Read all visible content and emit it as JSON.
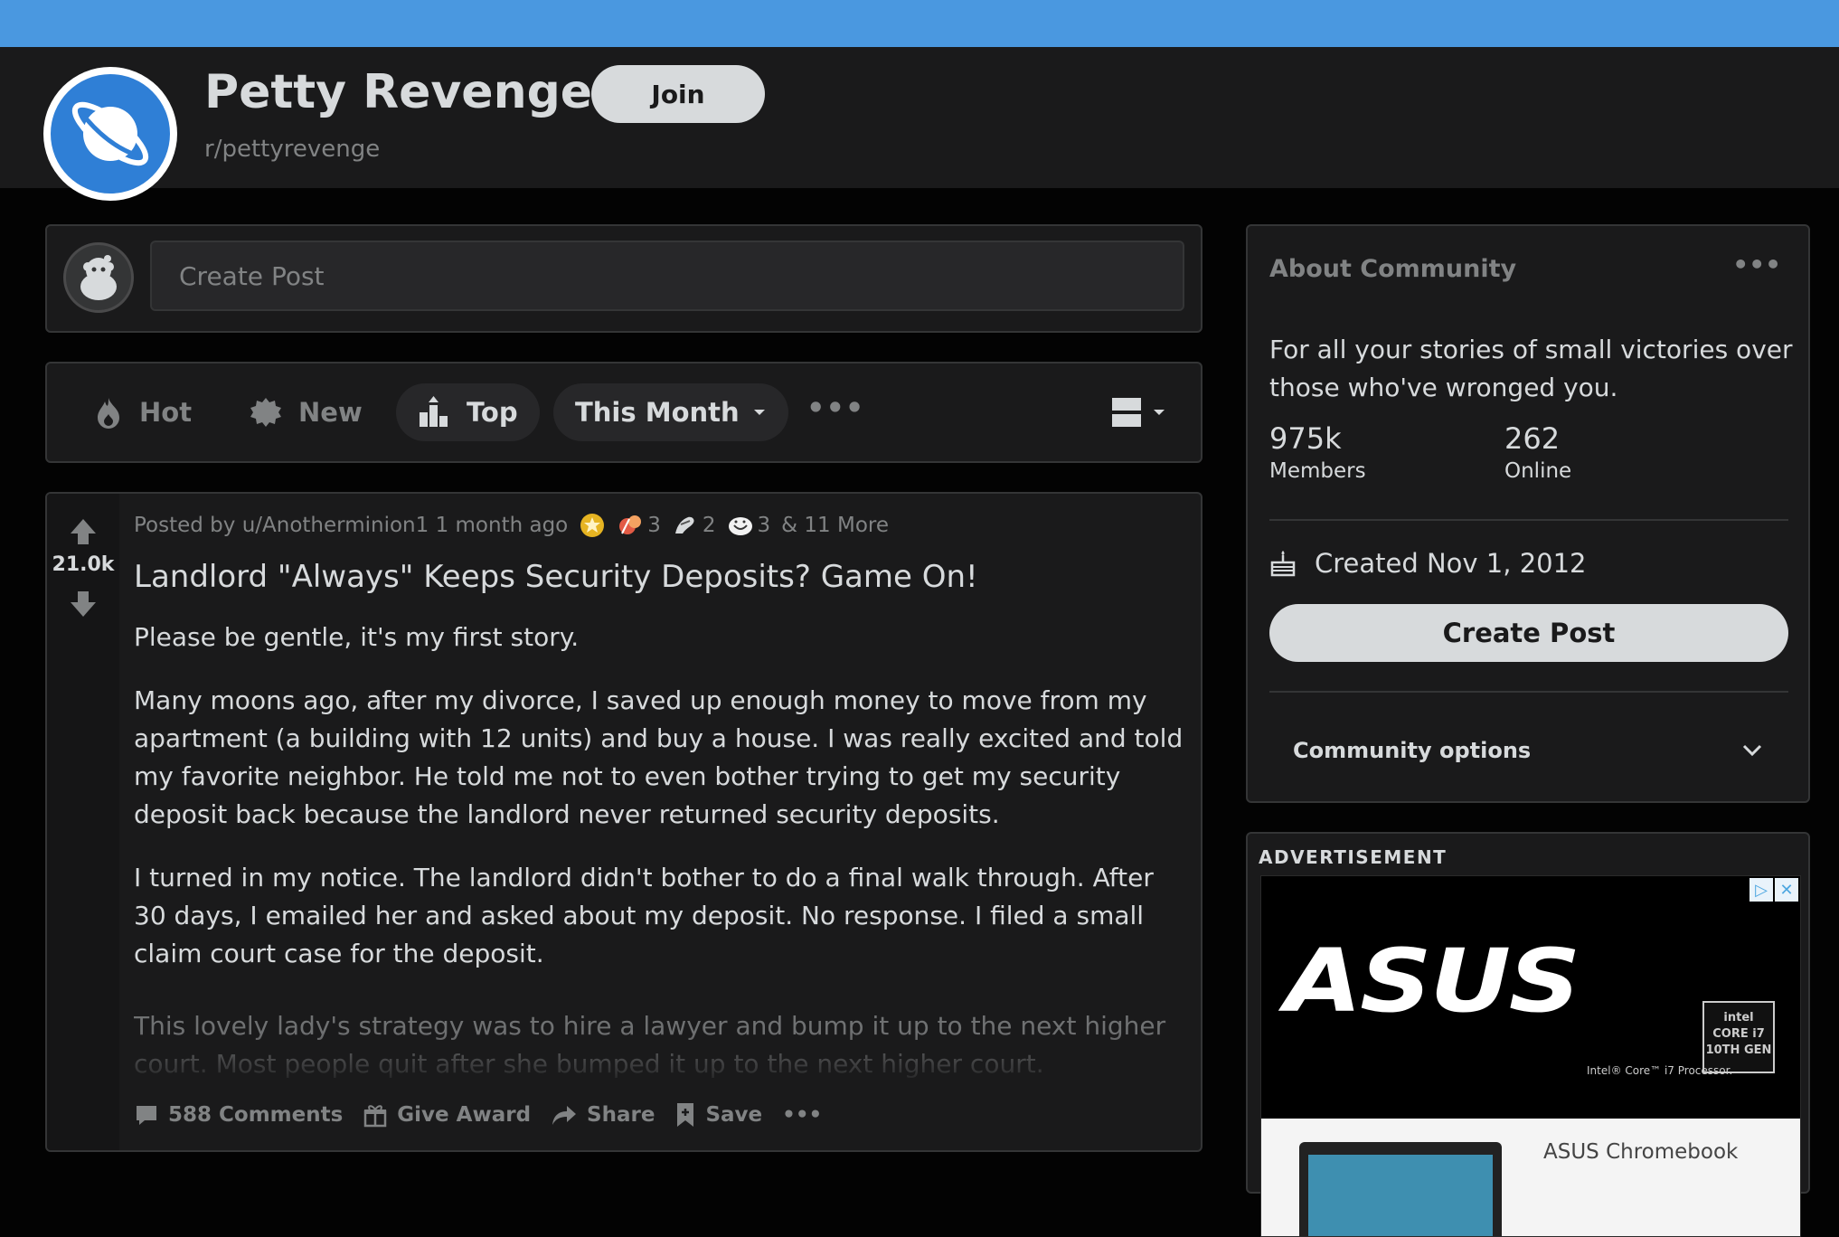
{
  "subreddit": {
    "title": "Petty Revenge",
    "name": "r/pettyrevenge",
    "join_label": "Join"
  },
  "create_post": {
    "placeholder": "Create Post"
  },
  "sort": {
    "hot": "Hot",
    "new": "New",
    "top": "Top",
    "period": "This Month",
    "more": "•••"
  },
  "post": {
    "score": "21.0k",
    "meta_prefix": "Posted by u/Anotherminion1 1 month ago",
    "awards": [
      {
        "icon": "gold-award-icon",
        "count": ""
      },
      {
        "icon": "wholesome-award-icon",
        "count": "3"
      },
      {
        "icon": "hands-award-icon",
        "count": "2"
      },
      {
        "icon": "laugh-award-icon",
        "count": "3"
      }
    ],
    "awards_more": "& 11 More",
    "title": "Landlord \"Always\" Keeps Security Deposits? Game On!",
    "paragraphs": [
      "Please be gentle, it's my first story.",
      "Many moons ago, after my divorce, I saved up enough money to move from my apartment (a building with 12 units) and buy a house. I was really excited and told my favorite neighbor. He told me not to even bother trying to get my security deposit back because the landlord never returned security deposits.",
      "I turned in my notice. The landlord didn't bother to do a final walk through. After 30 days, I emailed her and asked about my deposit. No response. I filed a small claim court case for the deposit."
    ],
    "faded": "This lovely lady's strategy was to hire a lawyer and bump it up to the next higher court. Most people quit after she bumped it up to the next higher court.",
    "comments": "588 Comments",
    "give_award": "Give Award",
    "share": "Share",
    "save": "Save",
    "more": "•••"
  },
  "about": {
    "title": "About Community",
    "more": "•••",
    "description": "For all your stories of small victories over those who've wronged you.",
    "members_count": "975k",
    "members_label": "Members",
    "online_count": "262",
    "online_label": "Online",
    "created": "Created Nov 1, 2012",
    "create_post": "Create Post",
    "options": "Community options"
  },
  "ad": {
    "label": "ADVERTISEMENT",
    "brand": "ASUS",
    "chip_text": "intel CORE i7 10TH GEN",
    "processor": "Intel® Core™ i7 Processor.",
    "product": "ASUS Chromebook"
  },
  "colors": {
    "banner": "#4a98e0",
    "background": "#030303",
    "panel": "#1a1a1b",
    "border": "#343536",
    "text": "#d7dadc",
    "muted": "#818384"
  }
}
